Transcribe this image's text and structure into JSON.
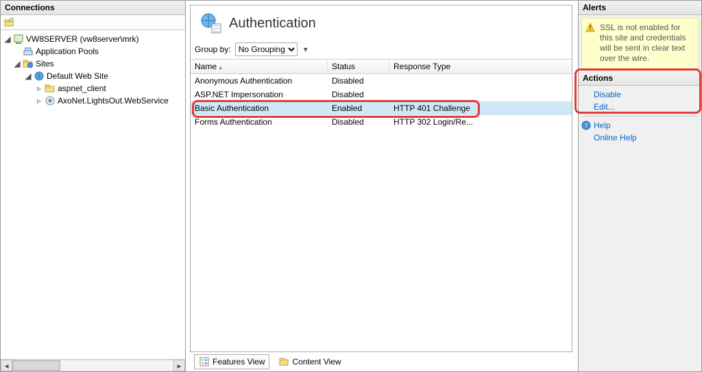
{
  "left": {
    "title": "Connections",
    "tree": {
      "server": "VW8SERVER (vw8server\\mrk)",
      "app_pools": "Application Pools",
      "sites": "Sites",
      "default_site": "Default Web Site",
      "aspnet_client": "aspnet_client",
      "axonet": "AxoNet.LightsOut.WebService"
    }
  },
  "center": {
    "heading": "Authentication",
    "groupby_label": "Group by:",
    "groupby_value": "No Grouping",
    "columns": {
      "name": "Name",
      "status": "Status",
      "resp": "Response Type"
    },
    "rows": [
      {
        "name": "Anonymous Authentication",
        "status": "Disabled",
        "resp": ""
      },
      {
        "name": "ASP.NET Impersonation",
        "status": "Disabled",
        "resp": ""
      },
      {
        "name": "Basic Authentication",
        "status": "Enabled",
        "resp": "HTTP 401 Challenge",
        "selected": true
      },
      {
        "name": "Forms Authentication",
        "status": "Disabled",
        "resp": "HTTP 302 Login/Re..."
      }
    ],
    "tabs": {
      "features": "Features View",
      "content": "Content View"
    }
  },
  "right": {
    "alerts_title": "Alerts",
    "alert_text": "SSL is not enabled for this site and credentials will be sent in clear text over the wire.",
    "actions_title": "Actions",
    "disable": "Disable",
    "edit": "Edit...",
    "help": "Help",
    "online_help": "Online Help"
  }
}
